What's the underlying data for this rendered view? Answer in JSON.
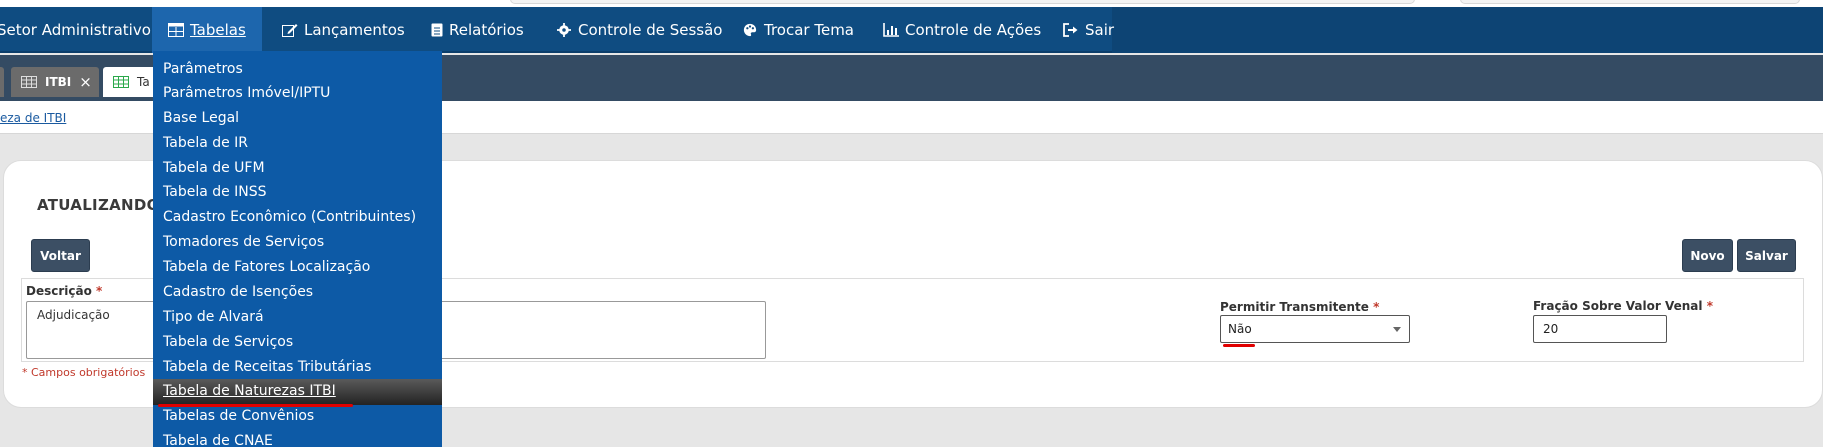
{
  "nav": {
    "items": [
      {
        "label": "Setor Administrativo",
        "icon": "none"
      },
      {
        "label": "Tabelas",
        "icon": "table-icon"
      },
      {
        "label": "Lançamentos",
        "icon": "edit-icon"
      },
      {
        "label": "Relatórios",
        "icon": "document-icon"
      },
      {
        "label": "Controle de Sessão",
        "icon": "gear-icon"
      },
      {
        "label": "Trocar Tema",
        "icon": "palette-icon"
      },
      {
        "label": "Controle de Ações",
        "icon": "chart-icon"
      },
      {
        "label": "Sair",
        "icon": "sign-out-icon"
      }
    ],
    "active_index": 1
  },
  "tabs": [
    {
      "label": "ITBI",
      "close": "×"
    },
    {
      "label": "Ta"
    }
  ],
  "breadcrumb": "eza de ITBI",
  "dropdown": {
    "items": [
      "Parâmetros",
      "Parâmetros Imóvel/IPTU",
      "Base Legal",
      "Tabela de IR",
      "Tabela de UFM",
      "Tabela de INSS",
      "Cadastro Econômico (Contribuintes)",
      "Tomadores de Serviços",
      "Tabela de Fatores Localização",
      "Cadastro de Isenções",
      "Tipo de Alvará",
      "Tabela de Serviços",
      "Tabela de Receitas Tributárias",
      "Tabela de Naturezas ITBI",
      "Tabelas de Convênios",
      "Tabela de CNAE"
    ],
    "highlighted_index": 13
  },
  "panel": {
    "title": "ATUALIZANDO",
    "back_button": "Voltar",
    "new_button": "Novo",
    "save_button": "Salvar",
    "description_label": "Descrição",
    "description_value": "Adjudicação",
    "transmitter_label": "Permitir Transmitente",
    "transmitter_value": "Não",
    "fraction_label": "Fração Sobre Valor Venal",
    "fraction_value": "20",
    "required_mark": "*",
    "required_note": "* Campos obrigatórios"
  },
  "colors": {
    "navbar": "#0f4c81",
    "nav_active": "#1d66ad",
    "dropdown": "#0d5aa6",
    "tabbar": "#344b63",
    "button": "#3c4f64",
    "required": "#c0392b",
    "annotation": "#e00000"
  }
}
